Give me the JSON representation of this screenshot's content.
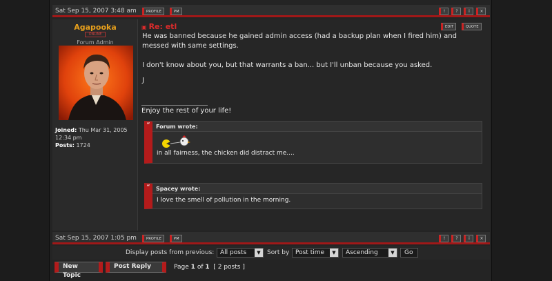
{
  "post_top_footer": {
    "date": "Sat Sep 15, 2007 3:48 am",
    "profile_label": "PROFILE",
    "pm_label": "PM"
  },
  "author": {
    "name": "Agapooka",
    "online_label": "ONLINE",
    "rank": "Forum Admin",
    "joined_label": "Joined:",
    "joined_value": "Thu Mar 31, 2005 12:34 pm",
    "posts_label": "Posts:",
    "posts_value": "1724"
  },
  "post": {
    "title": "Re: etl",
    "edit_label": "EDIT",
    "quote_label": "QUOTE",
    "paragraphs": [
      "He was banned because he gained admin access (had a backup plan when I fired him) and messed with same settings.",
      "I don't know about you, but that warrants a ban... but I'll unban because you asked.",
      "J"
    ],
    "signature": "Enjoy the rest of your life!",
    "quotes": [
      {
        "author": "Forum wrote:",
        "text": "in all fairness, the chicken did distract me...."
      },
      {
        "author": "Spacey wrote:",
        "text": "I love the smell of pollution in the morning."
      }
    ]
  },
  "post_bottom_footer": {
    "date": "Sat Sep 15, 2007 1:05 pm",
    "profile_label": "PROFILE",
    "pm_label": "PM"
  },
  "controls": {
    "display_label": "Display posts from previous:",
    "display_value": "All posts",
    "sort_label": "Sort by",
    "sort_value": "Post time",
    "order_value": "Ascending",
    "go_label": "Go"
  },
  "bottom_nav": {
    "new_topic": "New Topic",
    "post_reply": "Post Reply",
    "page_prefix": "Page",
    "page_current": "1",
    "page_of": "of",
    "page_total": "1",
    "posts_count": "[ 2 posts ]"
  }
}
